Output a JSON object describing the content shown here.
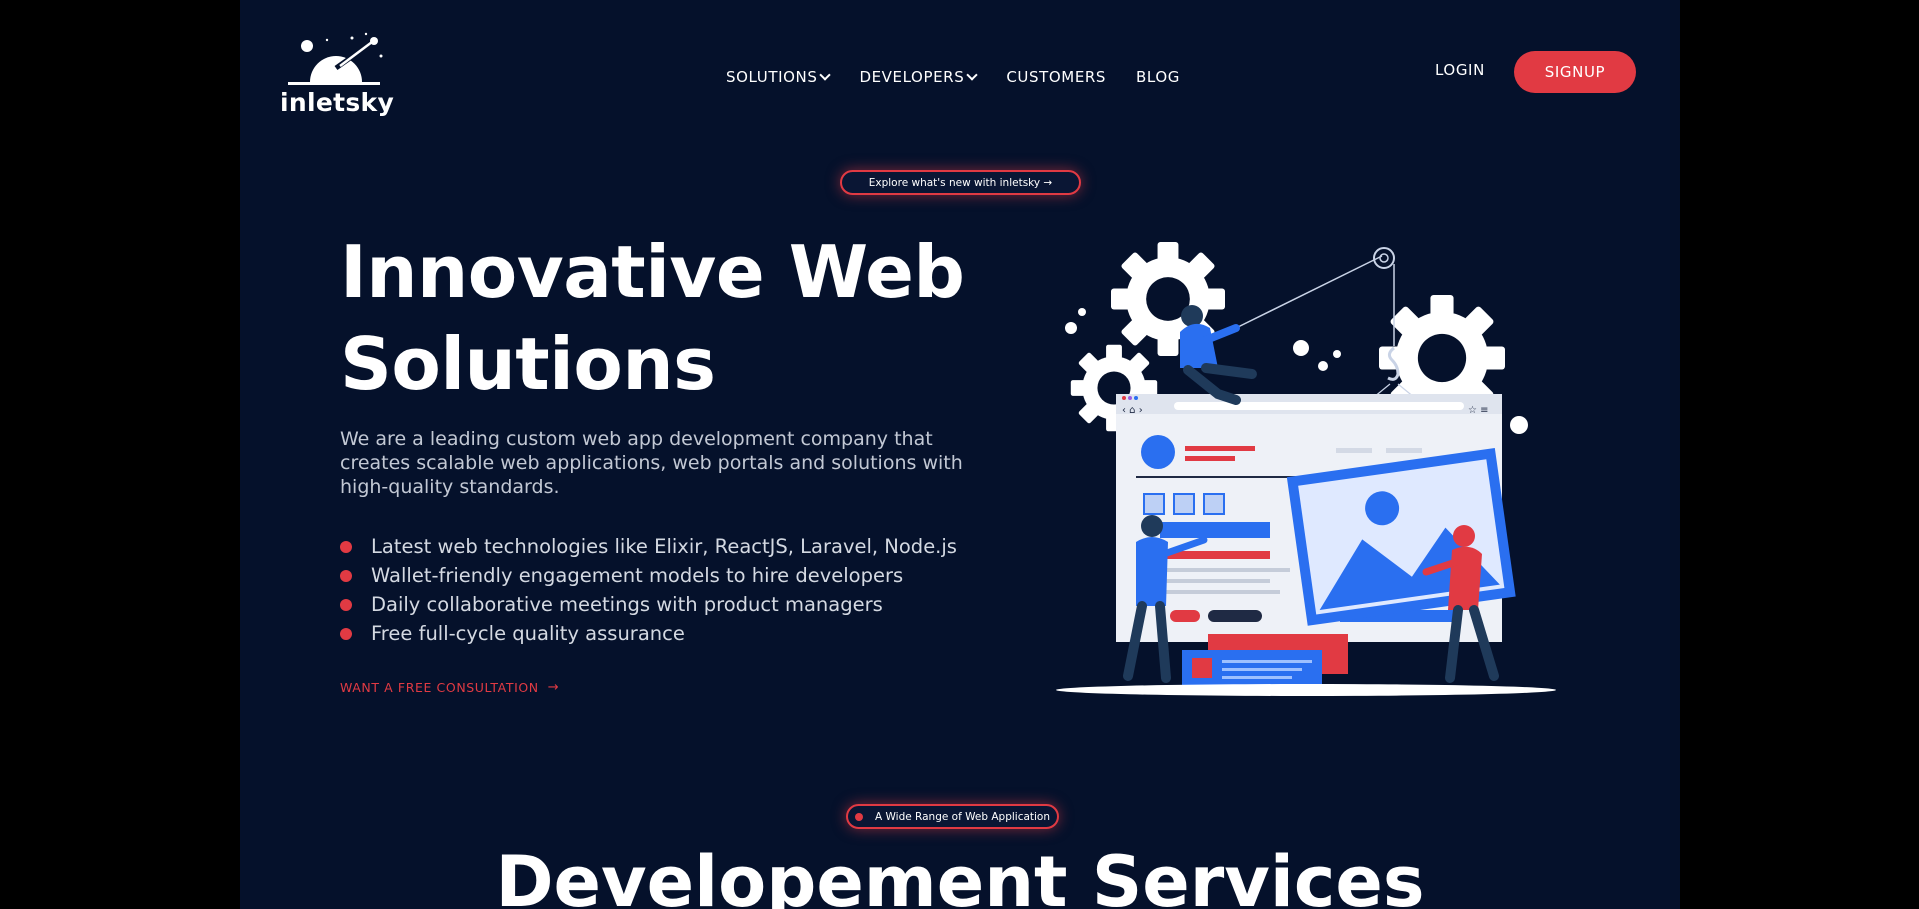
{
  "brand": {
    "name": "inletsky"
  },
  "nav": {
    "items": [
      {
        "label": "SOLUTIONS",
        "dropdown": true
      },
      {
        "label": "DEVELOPERS",
        "dropdown": true
      },
      {
        "label": "CUSTOMERS",
        "dropdown": false
      },
      {
        "label": "BLOG",
        "dropdown": false
      }
    ],
    "login_label": "LOGIN",
    "signup_label": "SIGNUP"
  },
  "announcement": {
    "label": "Explore what's new with inletsky →"
  },
  "hero": {
    "title_line1": "Innovative Web",
    "title_line2": "Solutions",
    "description": "We are a leading custom web app development company that creates scalable web applications, web portals and solutions with high-quality standards.",
    "features": [
      "Latest web technologies like Elixir, ReactJS, Laravel, Node.js",
      "Wallet-friendly engagement models to hire developers",
      "Daily collaborative meetings with product managers",
      "Free full-cycle quality assurance"
    ],
    "cta_label": "WANT A FREE CONSULTATION",
    "cta_icon": "arrow-right-icon"
  },
  "services": {
    "badge": "A Wide Range of Web Application",
    "title": "Developement Services"
  },
  "colors": {
    "background": "#05112b",
    "outer": "#000000",
    "accent": "#e13a43",
    "illustration_blue": "#2a6ff0"
  }
}
